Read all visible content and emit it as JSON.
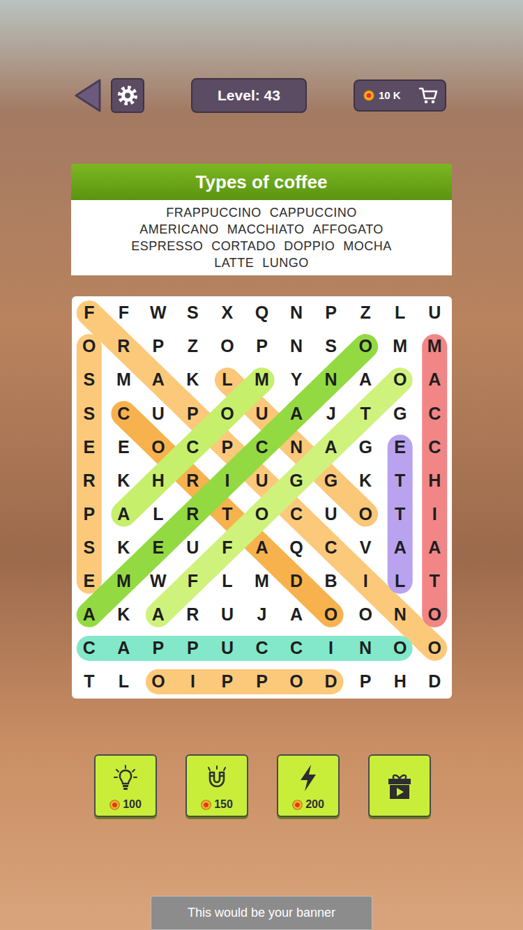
{
  "top_bar": {
    "level": "Level: 43",
    "coins": "10 K"
  },
  "word_panel": {
    "title": "Types of coffee",
    "word_lines": [
      [
        "FRAPPUCCINO",
        "CAPPUCCINO"
      ],
      [
        "AMERICANO",
        "MACCHIATO",
        "AFFOGATO"
      ],
      [
        "ESPRESSO",
        "CORTADO",
        "DOPPIO",
        "MOCHA"
      ],
      [
        "LATTE",
        "LUNGO"
      ]
    ]
  },
  "grid": {
    "rows": [
      [
        "F",
        "F",
        "W",
        "S",
        "X",
        "Q",
        "N",
        "P",
        "Z",
        "L",
        "U"
      ],
      [
        "O",
        "R",
        "P",
        "Z",
        "O",
        "P",
        "N",
        "S",
        "O",
        "M",
        "M"
      ],
      [
        "S",
        "M",
        "A",
        "K",
        "L",
        "M",
        "Y",
        "N",
        "A",
        "O",
        "A"
      ],
      [
        "S",
        "C",
        "U",
        "P",
        "O",
        "U",
        "A",
        "J",
        "T",
        "G",
        "C"
      ],
      [
        "E",
        "E",
        "O",
        "C",
        "P",
        "C",
        "N",
        "A",
        "G",
        "E",
        "C"
      ],
      [
        "R",
        "K",
        "H",
        "R",
        "I",
        "U",
        "G",
        "G",
        "K",
        "T",
        "H"
      ],
      [
        "P",
        "A",
        "L",
        "R",
        "T",
        "O",
        "C",
        "U",
        "O",
        "T",
        "I"
      ],
      [
        "S",
        "K",
        "E",
        "U",
        "F",
        "A",
        "Q",
        "C",
        "V",
        "A",
        "A"
      ],
      [
        "E",
        "M",
        "W",
        "F",
        "L",
        "M",
        "D",
        "B",
        "I",
        "L",
        "T"
      ],
      [
        "A",
        "K",
        "A",
        "R",
        "U",
        "J",
        "A",
        "O",
        "O",
        "N",
        "O"
      ],
      [
        "C",
        "A",
        "P",
        "P",
        "U",
        "C",
        "C",
        "I",
        "N",
        "O",
        "O"
      ],
      [
        "T",
        "L",
        "O",
        "I",
        "P",
        "P",
        "O",
        "D",
        "P",
        "H",
        "D"
      ]
    ]
  },
  "found": [
    {
      "start": [
        8,
        0
      ],
      "end": [
        1,
        0
      ],
      "color": "#fcc97a"
    },
    {
      "start": [
        0,
        0
      ],
      "end": [
        10,
        10
      ],
      "color": "#fcc97a"
    },
    {
      "start": [
        1,
        10
      ],
      "end": [
        9,
        10
      ],
      "color": "#f28585"
    },
    {
      "start": [
        8,
        9
      ],
      "end": [
        4,
        9
      ],
      "color": "#b9a2ee"
    },
    {
      "start": [
        10,
        0
      ],
      "end": [
        10,
        9
      ],
      "color": "#83e8c9"
    },
    {
      "start": [
        11,
        7
      ],
      "end": [
        11,
        2
      ],
      "color": "#fcc97a"
    },
    {
      "start": [
        3,
        1
      ],
      "end": [
        9,
        7
      ],
      "color": "#f7b24e"
    },
    {
      "start": [
        2,
        4
      ],
      "end": [
        6,
        8
      ],
      "color": "#fbc778"
    },
    {
      "start": [
        9,
        0
      ],
      "end": [
        1,
        8
      ],
      "color": "#93da42"
    },
    {
      "start": [
        2,
        5
      ],
      "end": [
        6,
        1
      ],
      "color": "#c6ef6c"
    },
    {
      "start": [
        9,
        2
      ],
      "end": [
        2,
        9
      ],
      "color": "#cff27c"
    }
  ],
  "tools": [
    {
      "kind": "hint",
      "cost": "100"
    },
    {
      "kind": "magnet",
      "cost": "150"
    },
    {
      "kind": "lightning",
      "cost": "200"
    },
    {
      "kind": "gift"
    }
  ],
  "banner": "This would be your banner"
}
